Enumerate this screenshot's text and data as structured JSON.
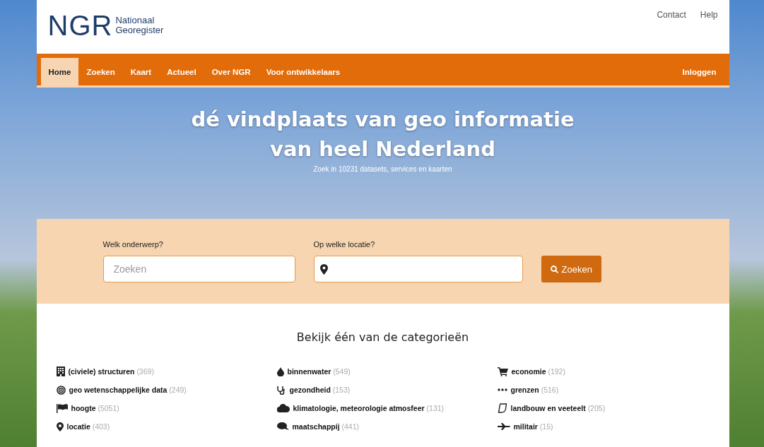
{
  "logo": {
    "mark": "NGR",
    "lines": [
      "Nationaal",
      "Georegister"
    ]
  },
  "top_links": [
    "Contact",
    "Help"
  ],
  "nav": {
    "items": [
      {
        "label": "Home",
        "selected": true
      },
      {
        "label": "Zoeken",
        "selected": false
      },
      {
        "label": "Kaart",
        "selected": false
      },
      {
        "label": "Actueel",
        "selected": false
      },
      {
        "label": "Over NGR",
        "selected": false
      },
      {
        "label": "Voor ontwikkelaars",
        "selected": false
      }
    ],
    "login": "Inloggen"
  },
  "hero": {
    "title": "dé vindplaats van geo informatie van heel Nederland",
    "subtitle": "Zoek in 10231 datasets, services en kaarten"
  },
  "search": {
    "subject_label": "Welk onderwerp?",
    "subject_placeholder": "Zoeken",
    "location_label": "Op welke locatie?",
    "button": "Zoeken"
  },
  "categories": {
    "heading": "Bekijk één van de categorieën",
    "items": [
      {
        "name": "(civiele) structuren",
        "count": "(369)"
      },
      {
        "name": "binnenwater",
        "count": "(549)"
      },
      {
        "name": "economie",
        "count": "(192)"
      },
      {
        "name": "geo wetenschappelijke data",
        "count": "(249)"
      },
      {
        "name": "gezondheid",
        "count": "(153)"
      },
      {
        "name": "grenzen",
        "count": "(516)"
      },
      {
        "name": "hoogte",
        "count": "(5051)"
      },
      {
        "name": "klimatologie, meteorologie atmosfeer",
        "count": "(131)"
      },
      {
        "name": "landbouw en veeteelt",
        "count": "(205)"
      },
      {
        "name": "locatie",
        "count": "(403)"
      },
      {
        "name": "maatschappij",
        "count": "(441)"
      },
      {
        "name": "militair",
        "count": "(15)"
      }
    ]
  }
}
